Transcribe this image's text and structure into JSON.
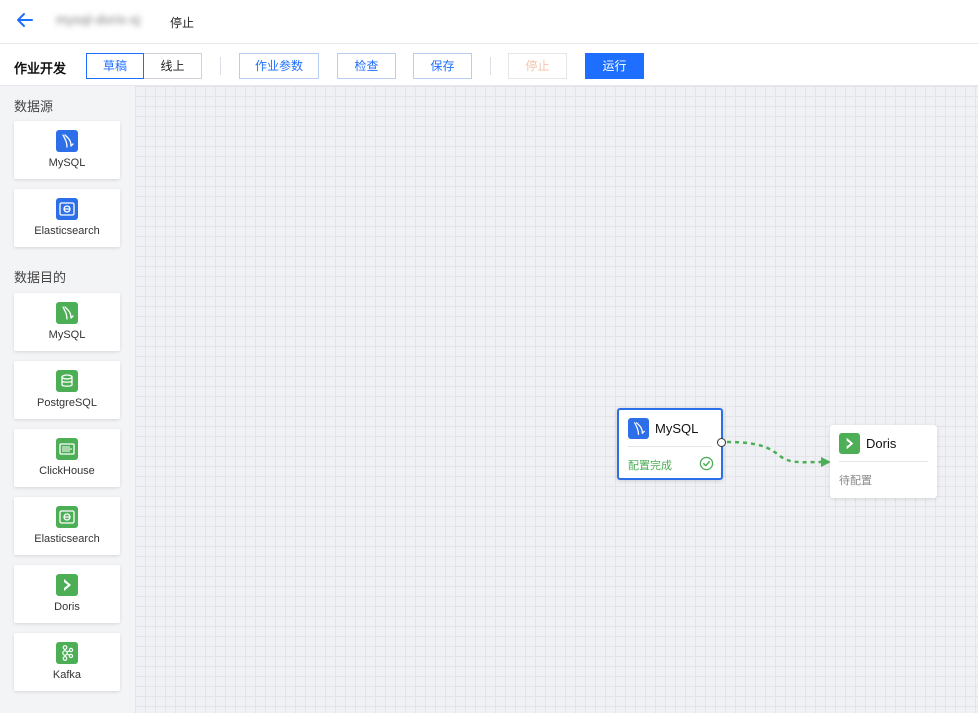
{
  "header": {
    "job_name": "mysql-doris-sj",
    "status": "停止"
  },
  "toolbar": {
    "title": "作业开发",
    "mode_tabs": [
      {
        "label": "草稿",
        "active": true
      },
      {
        "label": "线上",
        "active": false
      }
    ],
    "params_label": "作业参数",
    "check_label": "检查",
    "save_label": "保存",
    "stop_label": "停止",
    "run_label": "运行"
  },
  "sidebar": {
    "source_title": "数据源",
    "sources": [
      {
        "label": "MySQL",
        "icon": "mysql-icon"
      },
      {
        "label": "Elasticsearch",
        "icon": "elasticsearch-icon"
      }
    ],
    "target_title": "数据目的",
    "targets": [
      {
        "label": "MySQL",
        "icon": "mysql-icon"
      },
      {
        "label": "PostgreSQL",
        "icon": "postgresql-icon"
      },
      {
        "label": "ClickHouse",
        "icon": "clickhouse-icon"
      },
      {
        "label": "Elasticsearch",
        "icon": "elasticsearch-icon"
      },
      {
        "label": "Doris",
        "icon": "doris-icon"
      },
      {
        "label": "Kafka",
        "icon": "kafka-icon"
      }
    ]
  },
  "canvas": {
    "source_node": {
      "title": "MySQL",
      "status": "配置完成",
      "icon": "mysql-icon"
    },
    "target_node": {
      "title": "Doris",
      "status": "待配置",
      "icon": "doris-icon"
    }
  },
  "colors": {
    "primary": "#1e6fff",
    "source_icon": "#2d6fe8",
    "target_icon": "#4cae55",
    "success": "#4cae55"
  }
}
